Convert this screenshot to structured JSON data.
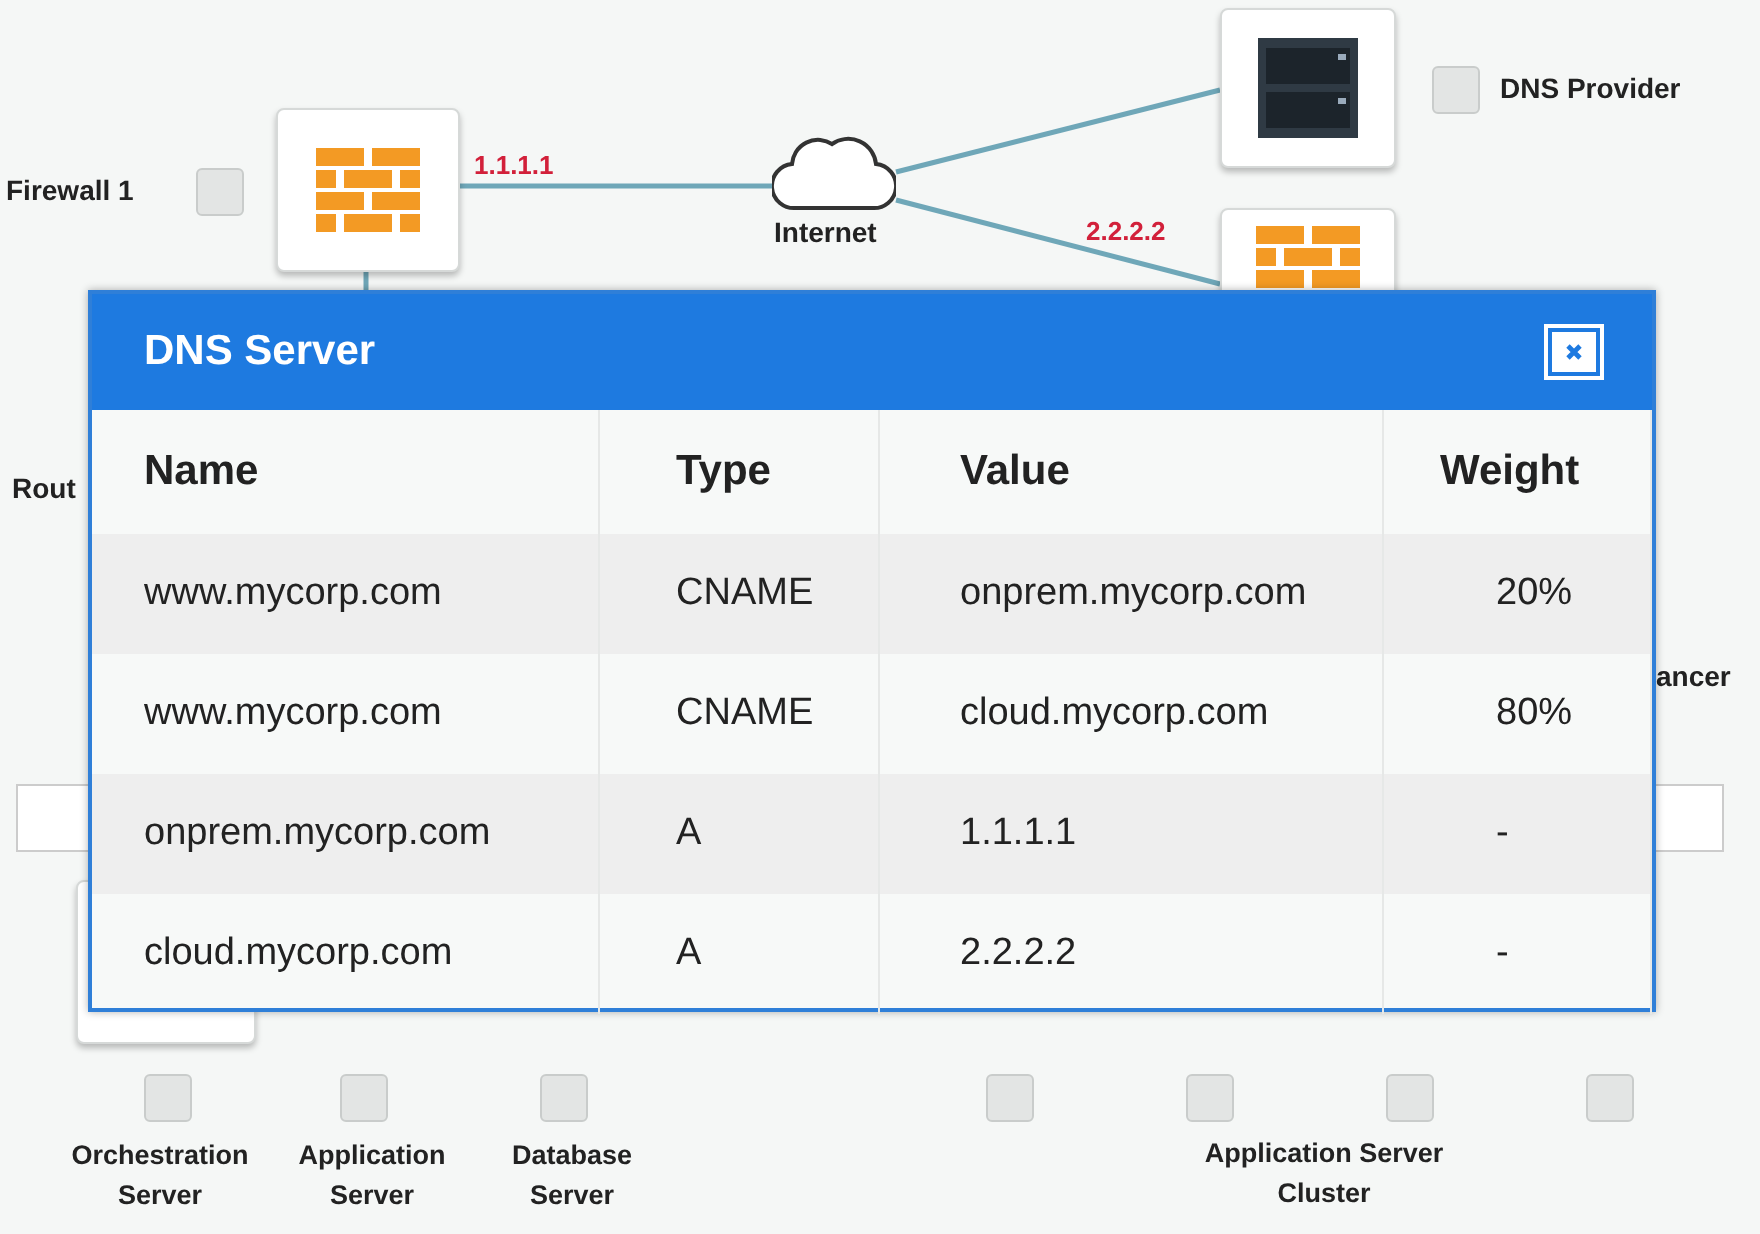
{
  "diagram": {
    "firewall_1": {
      "label": "Firewall 1",
      "checked": false
    },
    "dns_provider": {
      "label": "DNS Provider",
      "checked": false
    },
    "cloud_label": "Internet",
    "links": [
      {
        "label": "1.1.1.1"
      },
      {
        "label": "2.2.2.2"
      }
    ],
    "cut_labels": [
      "Rout",
      "ancer"
    ],
    "bottom_nodes": [
      {
        "label": "Orchestration Server",
        "checked": false
      },
      {
        "label": "Application Server",
        "checked": false
      },
      {
        "label": "Database Server",
        "checked": false
      },
      {
        "checked": false
      },
      {
        "checked": false
      },
      {
        "checked": false
      },
      {
        "checked": false
      }
    ],
    "cluster_label": "Application Server Cluster"
  },
  "dialog": {
    "title": "DNS Server",
    "columns": [
      "Name",
      "Type",
      "Value",
      "Weight"
    ],
    "rows": [
      [
        "www.mycorp.com",
        "CNAME",
        "onprem.mycorp.com",
        "20%"
      ],
      [
        "www.mycorp.com",
        "CNAME",
        "cloud.mycorp.com",
        "80%"
      ],
      [
        "onprem.mycorp.com",
        "A",
        "1.1.1.1",
        "-"
      ],
      [
        "cloud.mycorp.com",
        "A",
        "2.2.2.2",
        "-"
      ]
    ]
  }
}
